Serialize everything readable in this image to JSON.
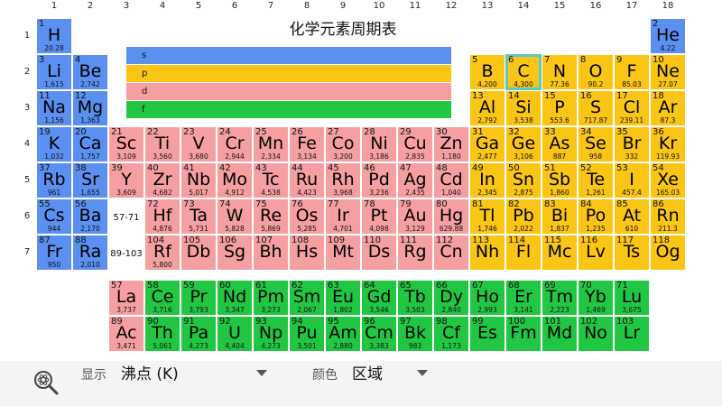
{
  "title": "化学元素周期表",
  "group_numbers": [
    "1",
    "2",
    "3",
    "4",
    "5",
    "6",
    "7",
    "8",
    "9",
    "10",
    "11",
    "12",
    "13",
    "14",
    "15",
    "16",
    "17",
    "18"
  ],
  "period_numbers": [
    "1",
    "2",
    "3",
    "4",
    "5",
    "6",
    "7"
  ],
  "legend": [
    {
      "label": "s",
      "category": "s"
    },
    {
      "label": "p",
      "category": "p"
    },
    {
      "label": "d",
      "category": "d"
    },
    {
      "label": "f",
      "category": "f"
    }
  ],
  "colors": {
    "s": "#5b8ff0",
    "p": "#fac515",
    "d": "#f59fa2",
    "f": "#21c743",
    "selected_border": "#58c9c8"
  },
  "selected_symbol": "C",
  "range_labels": {
    "lanthanides": "57-71",
    "actinides": "89-103"
  },
  "elements": [
    {
      "n": "1",
      "s": "H",
      "v": "20.28",
      "g": 1,
      "p": 1,
      "c": "s"
    },
    {
      "n": "2",
      "s": "He",
      "v": "4.22",
      "g": 18,
      "p": 1,
      "c": "s"
    },
    {
      "n": "3",
      "s": "Li",
      "v": "1,615",
      "g": 1,
      "p": 2,
      "c": "s"
    },
    {
      "n": "4",
      "s": "Be",
      "v": "2,742",
      "g": 2,
      "p": 2,
      "c": "s"
    },
    {
      "n": "5",
      "s": "B",
      "v": "4,200",
      "g": 13,
      "p": 2,
      "c": "p"
    },
    {
      "n": "6",
      "s": "C",
      "v": "4,300",
      "g": 14,
      "p": 2,
      "c": "p"
    },
    {
      "n": "7",
      "s": "N",
      "v": "77.36",
      "g": 15,
      "p": 2,
      "c": "p"
    },
    {
      "n": "8",
      "s": "O",
      "v": "90.2",
      "g": 16,
      "p": 2,
      "c": "p"
    },
    {
      "n": "9",
      "s": "F",
      "v": "85.03",
      "g": 17,
      "p": 2,
      "c": "p"
    },
    {
      "n": "10",
      "s": "Ne",
      "v": "27.07",
      "g": 18,
      "p": 2,
      "c": "p"
    },
    {
      "n": "11",
      "s": "Na",
      "v": "1,156",
      "g": 1,
      "p": 3,
      "c": "s"
    },
    {
      "n": "12",
      "s": "Mg",
      "v": "1,363",
      "g": 2,
      "p": 3,
      "c": "s"
    },
    {
      "n": "13",
      "s": "Al",
      "v": "2,792",
      "g": 13,
      "p": 3,
      "c": "p"
    },
    {
      "n": "14",
      "s": "Si",
      "v": "3,538",
      "g": 14,
      "p": 3,
      "c": "p"
    },
    {
      "n": "15",
      "s": "P",
      "v": "553.6",
      "g": 15,
      "p": 3,
      "c": "p"
    },
    {
      "n": "16",
      "s": "S",
      "v": "717.87",
      "g": 16,
      "p": 3,
      "c": "p"
    },
    {
      "n": "17",
      "s": "Cl",
      "v": "239.11",
      "g": 17,
      "p": 3,
      "c": "p"
    },
    {
      "n": "18",
      "s": "Ar",
      "v": "87.3",
      "g": 18,
      "p": 3,
      "c": "p"
    },
    {
      "n": "19",
      "s": "K",
      "v": "1,032",
      "g": 1,
      "p": 4,
      "c": "s"
    },
    {
      "n": "20",
      "s": "Ca",
      "v": "1,757",
      "g": 2,
      "p": 4,
      "c": "s"
    },
    {
      "n": "21",
      "s": "Sc",
      "v": "3,109",
      "g": 3,
      "p": 4,
      "c": "d"
    },
    {
      "n": "22",
      "s": "Ti",
      "v": "3,560",
      "g": 4,
      "p": 4,
      "c": "d"
    },
    {
      "n": "23",
      "s": "V",
      "v": "3,680",
      "g": 5,
      "p": 4,
      "c": "d"
    },
    {
      "n": "24",
      "s": "Cr",
      "v": "2,944",
      "g": 6,
      "p": 4,
      "c": "d"
    },
    {
      "n": "25",
      "s": "Mn",
      "v": "2,334",
      "g": 7,
      "p": 4,
      "c": "d"
    },
    {
      "n": "26",
      "s": "Fe",
      "v": "3,134",
      "g": 8,
      "p": 4,
      "c": "d"
    },
    {
      "n": "27",
      "s": "Co",
      "v": "3,200",
      "g": 9,
      "p": 4,
      "c": "d"
    },
    {
      "n": "28",
      "s": "Ni",
      "v": "3,186",
      "g": 10,
      "p": 4,
      "c": "d"
    },
    {
      "n": "29",
      "s": "Cu",
      "v": "2,835",
      "g": 11,
      "p": 4,
      "c": "d"
    },
    {
      "n": "30",
      "s": "Zn",
      "v": "1,180",
      "g": 12,
      "p": 4,
      "c": "d"
    },
    {
      "n": "31",
      "s": "Ga",
      "v": "2,477",
      "g": 13,
      "p": 4,
      "c": "p"
    },
    {
      "n": "32",
      "s": "Ge",
      "v": "3,106",
      "g": 14,
      "p": 4,
      "c": "p"
    },
    {
      "n": "33",
      "s": "As",
      "v": "887",
      "g": 15,
      "p": 4,
      "c": "p"
    },
    {
      "n": "34",
      "s": "Se",
      "v": "958",
      "g": 16,
      "p": 4,
      "c": "p"
    },
    {
      "n": "35",
      "s": "Br",
      "v": "332",
      "g": 17,
      "p": 4,
      "c": "p"
    },
    {
      "n": "36",
      "s": "Kr",
      "v": "119.93",
      "g": 18,
      "p": 4,
      "c": "p"
    },
    {
      "n": "37",
      "s": "Rb",
      "v": "961",
      "g": 1,
      "p": 5,
      "c": "s"
    },
    {
      "n": "38",
      "s": "Sr",
      "v": "1,655",
      "g": 2,
      "p": 5,
      "c": "s"
    },
    {
      "n": "39",
      "s": "Y",
      "v": "3,609",
      "g": 3,
      "p": 5,
      "c": "d"
    },
    {
      "n": "40",
      "s": "Zr",
      "v": "4,682",
      "g": 4,
      "p": 5,
      "c": "d"
    },
    {
      "n": "41",
      "s": "Nb",
      "v": "5,017",
      "g": 5,
      "p": 5,
      "c": "d"
    },
    {
      "n": "42",
      "s": "Mo",
      "v": "4,912",
      "g": 6,
      "p": 5,
      "c": "d"
    },
    {
      "n": "43",
      "s": "Tc",
      "v": "4,538",
      "g": 7,
      "p": 5,
      "c": "d"
    },
    {
      "n": "44",
      "s": "Ru",
      "v": "4,423",
      "g": 8,
      "p": 5,
      "c": "d"
    },
    {
      "n": "45",
      "s": "Rh",
      "v": "3,968",
      "g": 9,
      "p": 5,
      "c": "d"
    },
    {
      "n": "46",
      "s": "Pd",
      "v": "3,236",
      "g": 10,
      "p": 5,
      "c": "d"
    },
    {
      "n": "47",
      "s": "Ag",
      "v": "2,435",
      "g": 11,
      "p": 5,
      "c": "d"
    },
    {
      "n": "48",
      "s": "Cd",
      "v": "1,040",
      "g": 12,
      "p": 5,
      "c": "d"
    },
    {
      "n": "49",
      "s": "In",
      "v": "2,345",
      "g": 13,
      "p": 5,
      "c": "p"
    },
    {
      "n": "50",
      "s": "Sn",
      "v": "2,875",
      "g": 14,
      "p": 5,
      "c": "p"
    },
    {
      "n": "51",
      "s": "Sb",
      "v": "1,860",
      "g": 15,
      "p": 5,
      "c": "p"
    },
    {
      "n": "52",
      "s": "Te",
      "v": "1,261",
      "g": 16,
      "p": 5,
      "c": "p"
    },
    {
      "n": "53",
      "s": "I",
      "v": "457.4",
      "g": 17,
      "p": 5,
      "c": "p"
    },
    {
      "n": "54",
      "s": "Xe",
      "v": "165.03",
      "g": 18,
      "p": 5,
      "c": "p"
    },
    {
      "n": "55",
      "s": "Cs",
      "v": "944",
      "g": 1,
      "p": 6,
      "c": "s"
    },
    {
      "n": "56",
      "s": "Ba",
      "v": "2,170",
      "g": 2,
      "p": 6,
      "c": "s"
    },
    {
      "n": "72",
      "s": "Hf",
      "v": "4,876",
      "g": 4,
      "p": 6,
      "c": "d"
    },
    {
      "n": "73",
      "s": "Ta",
      "v": "5,731",
      "g": 5,
      "p": 6,
      "c": "d"
    },
    {
      "n": "74",
      "s": "W",
      "v": "5,828",
      "g": 6,
      "p": 6,
      "c": "d"
    },
    {
      "n": "75",
      "s": "Re",
      "v": "5,869",
      "g": 7,
      "p": 6,
      "c": "d"
    },
    {
      "n": "76",
      "s": "Os",
      "v": "5,285",
      "g": 8,
      "p": 6,
      "c": "d"
    },
    {
      "n": "77",
      "s": "Ir",
      "v": "4,701",
      "g": 9,
      "p": 6,
      "c": "d"
    },
    {
      "n": "78",
      "s": "Pt",
      "v": "4,098",
      "g": 10,
      "p": 6,
      "c": "d"
    },
    {
      "n": "79",
      "s": "Au",
      "v": "3,129",
      "g": 11,
      "p": 6,
      "c": "d"
    },
    {
      "n": "80",
      "s": "Hg",
      "v": "629.88",
      "g": 12,
      "p": 6,
      "c": "d"
    },
    {
      "n": "81",
      "s": "Tl",
      "v": "1,746",
      "g": 13,
      "p": 6,
      "c": "p"
    },
    {
      "n": "82",
      "s": "Pb",
      "v": "2,022",
      "g": 14,
      "p": 6,
      "c": "p"
    },
    {
      "n": "83",
      "s": "Bi",
      "v": "1,837",
      "g": 15,
      "p": 6,
      "c": "p"
    },
    {
      "n": "84",
      "s": "Po",
      "v": "1,235",
      "g": 16,
      "p": 6,
      "c": "p"
    },
    {
      "n": "85",
      "s": "At",
      "v": "610",
      "g": 17,
      "p": 6,
      "c": "p"
    },
    {
      "n": "86",
      "s": "Rn",
      "v": "211.3",
      "g": 18,
      "p": 6,
      "c": "p"
    },
    {
      "n": "87",
      "s": "Fr",
      "v": "950",
      "g": 1,
      "p": 7,
      "c": "s"
    },
    {
      "n": "88",
      "s": "Ra",
      "v": "2,010",
      "g": 2,
      "p": 7,
      "c": "s"
    },
    {
      "n": "104",
      "s": "Rf",
      "v": "5,800",
      "g": 4,
      "p": 7,
      "c": "d"
    },
    {
      "n": "105",
      "s": "Db",
      "v": "",
      "g": 5,
      "p": 7,
      "c": "d"
    },
    {
      "n": "106",
      "s": "Sg",
      "v": "",
      "g": 6,
      "p": 7,
      "c": "d"
    },
    {
      "n": "107",
      "s": "Bh",
      "v": "",
      "g": 7,
      "p": 7,
      "c": "d"
    },
    {
      "n": "108",
      "s": "Hs",
      "v": "",
      "g": 8,
      "p": 7,
      "c": "d"
    },
    {
      "n": "109",
      "s": "Mt",
      "v": "",
      "g": 9,
      "p": 7,
      "c": "d"
    },
    {
      "n": "110",
      "s": "Ds",
      "v": "",
      "g": 10,
      "p": 7,
      "c": "d"
    },
    {
      "n": "111",
      "s": "Rg",
      "v": "",
      "g": 11,
      "p": 7,
      "c": "d"
    },
    {
      "n": "112",
      "s": "Cn",
      "v": "",
      "g": 12,
      "p": 7,
      "c": "d"
    },
    {
      "n": "113",
      "s": "Nh",
      "v": "",
      "g": 13,
      "p": 7,
      "c": "p"
    },
    {
      "n": "114",
      "s": "Fl",
      "v": "",
      "g": 14,
      "p": 7,
      "c": "p"
    },
    {
      "n": "115",
      "s": "Mc",
      "v": "",
      "g": 15,
      "p": 7,
      "c": "p"
    },
    {
      "n": "116",
      "s": "Lv",
      "v": "",
      "g": 16,
      "p": 7,
      "c": "p"
    },
    {
      "n": "117",
      "s": "Ts",
      "v": "",
      "g": 17,
      "p": 7,
      "c": "p"
    },
    {
      "n": "118",
      "s": "Og",
      "v": "",
      "g": 18,
      "p": 7,
      "c": "p"
    }
  ],
  "lanthanides": [
    {
      "n": "57",
      "s": "La",
      "v": "3,737",
      "c": "d"
    },
    {
      "n": "58",
      "s": "Ce",
      "v": "3,716",
      "c": "f"
    },
    {
      "n": "59",
      "s": "Pr",
      "v": "3,793",
      "c": "f"
    },
    {
      "n": "60",
      "s": "Nd",
      "v": "3,347",
      "c": "f"
    },
    {
      "n": "61",
      "s": "Pm",
      "v": "3,273",
      "c": "f"
    },
    {
      "n": "62",
      "s": "Sm",
      "v": "2,067",
      "c": "f"
    },
    {
      "n": "63",
      "s": "Eu",
      "v": "1,802",
      "c": "f"
    },
    {
      "n": "64",
      "s": "Gd",
      "v": "3,546",
      "c": "f"
    },
    {
      "n": "65",
      "s": "Tb",
      "v": "3,503",
      "c": "f"
    },
    {
      "n": "66",
      "s": "Dy",
      "v": "2,840",
      "c": "f"
    },
    {
      "n": "67",
      "s": "Ho",
      "v": "2,993",
      "c": "f"
    },
    {
      "n": "68",
      "s": "Er",
      "v": "3,141",
      "c": "f"
    },
    {
      "n": "69",
      "s": "Tm",
      "v": "2,223",
      "c": "f"
    },
    {
      "n": "70",
      "s": "Yb",
      "v": "1,469",
      "c": "f"
    },
    {
      "n": "71",
      "s": "Lu",
      "v": "3,675",
      "c": "f"
    }
  ],
  "actinides": [
    {
      "n": "89",
      "s": "Ac",
      "v": "3,471",
      "c": "d"
    },
    {
      "n": "90",
      "s": "Th",
      "v": "5,061",
      "c": "f"
    },
    {
      "n": "91",
      "s": "Pa",
      "v": "4,273",
      "c": "f"
    },
    {
      "n": "92",
      "s": "U",
      "v": "4,404",
      "c": "f"
    },
    {
      "n": "93",
      "s": "Np",
      "v": "4,273",
      "c": "f"
    },
    {
      "n": "94",
      "s": "Pu",
      "v": "3,501",
      "c": "f"
    },
    {
      "n": "95",
      "s": "Am",
      "v": "2,880",
      "c": "f"
    },
    {
      "n": "96",
      "s": "Cm",
      "v": "3,383",
      "c": "f"
    },
    {
      "n": "97",
      "s": "Bk",
      "v": "983",
      "c": "f"
    },
    {
      "n": "98",
      "s": "Cf",
      "v": "1,173",
      "c": "f"
    },
    {
      "n": "99",
      "s": "Es",
      "v": "",
      "c": "f"
    },
    {
      "n": "100",
      "s": "Fm",
      "v": "",
      "c": "f"
    },
    {
      "n": "101",
      "s": "Md",
      "v": "",
      "c": "f"
    },
    {
      "n": "102",
      "s": "No",
      "v": "",
      "c": "f"
    },
    {
      "n": "103",
      "s": "Lr",
      "v": "",
      "c": "f"
    }
  ],
  "bottom_bar": {
    "search_icon": "magnifier-atom-icon",
    "display_label": "显示",
    "display_value": "沸点 (K)",
    "color_label": "颜色",
    "color_value": "区域"
  }
}
